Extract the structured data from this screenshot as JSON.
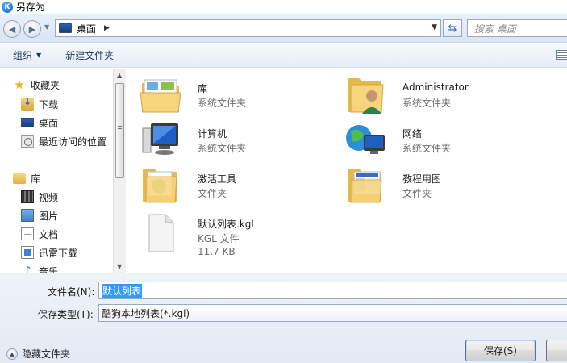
{
  "window": {
    "title": "另存为"
  },
  "address": {
    "location": "桌面",
    "search_placeholder": "搜索 桌面"
  },
  "toolbar": {
    "organize_label": "组织",
    "new_folder_label": "新建文件夹"
  },
  "nav": {
    "favorites_label": "收藏夹",
    "favorites": [
      {
        "label": "下载",
        "icon": "download-icon"
      },
      {
        "label": "桌面",
        "icon": "desktop-icon"
      },
      {
        "label": "最近访问的位置",
        "icon": "recent-places-icon"
      }
    ],
    "libraries_label": "库",
    "libraries": [
      {
        "label": "视频",
        "icon": "video-icon"
      },
      {
        "label": "图片",
        "icon": "pictures-icon"
      },
      {
        "label": "文档",
        "icon": "documents-icon"
      },
      {
        "label": "迅雷下载",
        "icon": "thunder-download-icon"
      },
      {
        "label": "音乐",
        "icon": "music-icon"
      }
    ]
  },
  "files": [
    {
      "name": "库",
      "type": "系统文件夹",
      "icon": "library-folder-icon"
    },
    {
      "name": "Administrator",
      "type": "系统文件夹",
      "icon": "user-folder-icon"
    },
    {
      "name": "计算机",
      "type": "系统文件夹",
      "icon": "computer-icon"
    },
    {
      "name": "网络",
      "type": "系统文件夹",
      "icon": "network-icon"
    },
    {
      "name": "激活工具",
      "type": "文件夹",
      "icon": "folder-icon"
    },
    {
      "name": "教程用图",
      "type": "文件夹",
      "icon": "folder-icon"
    },
    {
      "name": "默认列表.kgl",
      "type": "KGL 文件",
      "size": "11.7 KB",
      "icon": "file-icon"
    }
  ],
  "form": {
    "filename_label": "文件名(N):",
    "filename_value": "默认列表",
    "filetype_label": "保存类型(T):",
    "filetype_value": "酷狗本地列表(*.kgl)"
  },
  "footer": {
    "hide_folders_label": "隐藏文件夹",
    "save_label": "保存(S)"
  }
}
